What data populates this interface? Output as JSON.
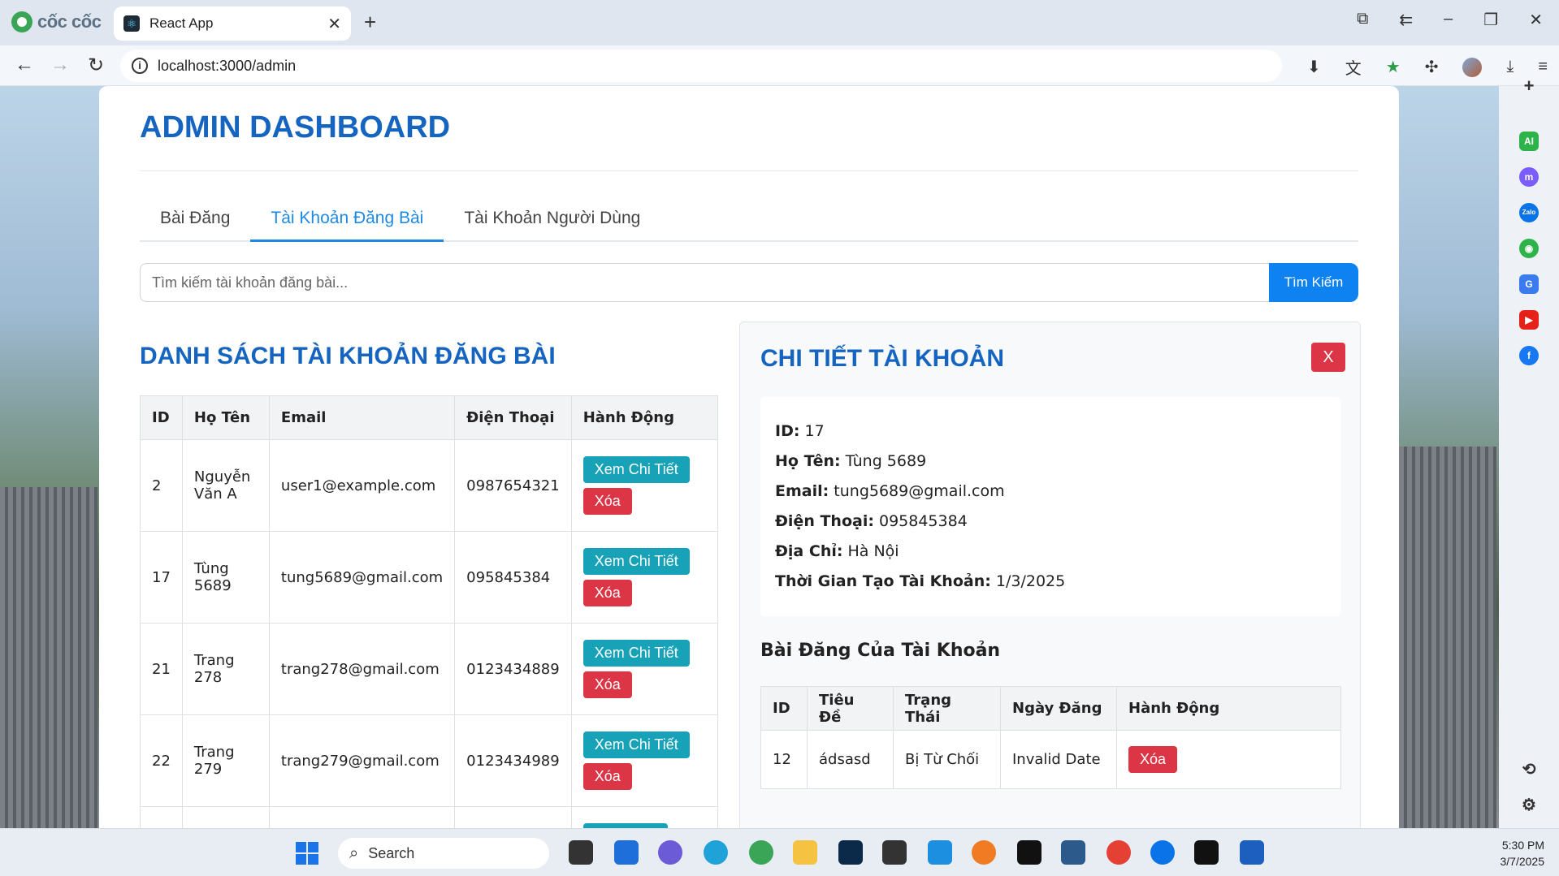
{
  "browser": {
    "brand": "cốc cốc",
    "tab_title": "React App",
    "url": "localhost:3000/admin"
  },
  "dashboard": {
    "title": "ADMIN DASHBOARD",
    "tabs": [
      "Bài Đăng",
      "Tài Khoản Đăng Bài",
      "Tài Khoản Người Dùng"
    ],
    "active_tab": 1,
    "search_placeholder": "Tìm kiếm tài khoản đăng bài...",
    "search_button": "Tìm Kiếm"
  },
  "accounts": {
    "title": "DANH SÁCH TÀI KHOẢN ĐĂNG BÀI",
    "columns": [
      "ID",
      "Họ Tên",
      "Email",
      "Điện Thoại",
      "Hành Động"
    ],
    "view_label": "Xem Chi Tiết",
    "delete_label": "Xóa",
    "rows": [
      {
        "id": "2",
        "name": "Nguyễn Văn A",
        "email": "user1@example.com",
        "phone": "0987654321"
      },
      {
        "id": "17",
        "name": "Tùng 5689",
        "email": "tung5689@gmail.com",
        "phone": "095845384"
      },
      {
        "id": "21",
        "name": "Trang 278",
        "email": "trang278@gmail.com",
        "phone": "0123434889"
      },
      {
        "id": "22",
        "name": "Trang 279",
        "email": "trang279@gmail.com",
        "phone": "0123434989"
      }
    ]
  },
  "detail": {
    "title": "CHI TIẾT TÀI KHOẢN",
    "close_label": "X",
    "fields": [
      {
        "label": "ID:",
        "value": "17"
      },
      {
        "label": "Họ Tên:",
        "value": "Tùng 5689"
      },
      {
        "label": "Email:",
        "value": "tung5689@gmail.com"
      },
      {
        "label": "Điện Thoại:",
        "value": "095845384"
      },
      {
        "label": "Địa Chỉ:",
        "value": "Hà Nội"
      },
      {
        "label": "Thời Gian Tạo Tài Khoản:",
        "value": "1/3/2025"
      }
    ],
    "posts_title": "Bài Đăng Của Tài Khoản",
    "post_columns": [
      "ID",
      "Tiêu Đề",
      "Trạng Thái",
      "Ngày Đăng",
      "Hành Động"
    ],
    "posts": [
      {
        "id": "12",
        "title": "ádsasd",
        "status": "Bị Từ Chối",
        "date": "Invalid Date"
      }
    ],
    "post_delete_label": "Xóa"
  },
  "taskbar": {
    "search_label": "Search",
    "time": "5:30 PM",
    "date": "3/7/2025"
  }
}
